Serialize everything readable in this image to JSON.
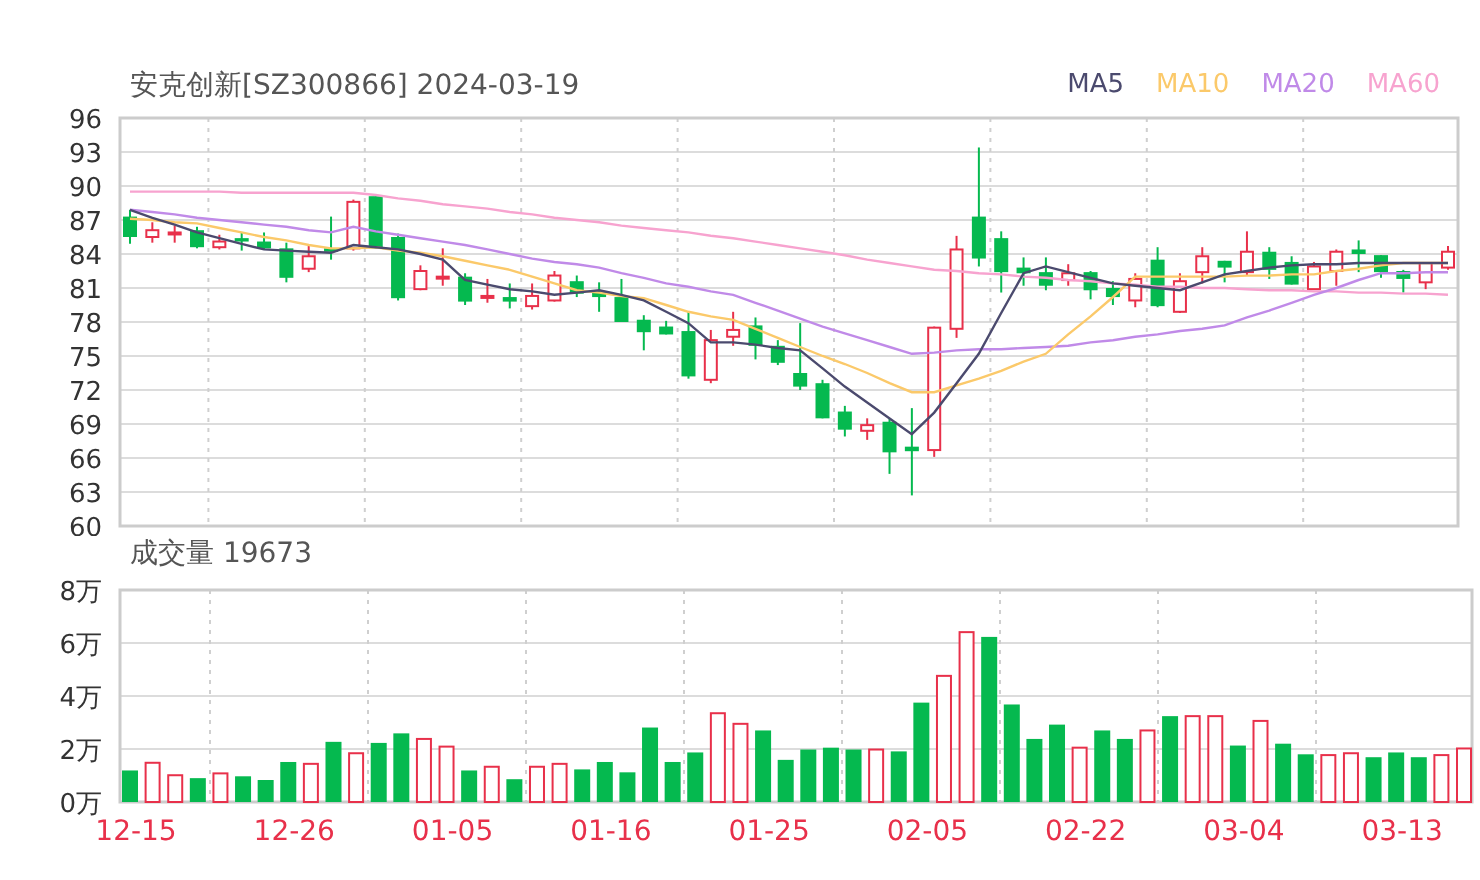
{
  "header": {
    "title": "安克创新[SZ300866] 2024-03-19"
  },
  "price_chart": {
    "chart_data": {
      "type": "candlestick",
      "grid": true,
      "categories": [
        null,
        null,
        null,
        null,
        null,
        null,
        null,
        null,
        null,
        null,
        null,
        null,
        null,
        null,
        null,
        null,
        null,
        null,
        null,
        null,
        null,
        null,
        null,
        null,
        null,
        null,
        null,
        null,
        null,
        null,
        null,
        null,
        null,
        null,
        null,
        null,
        null,
        null,
        null,
        null,
        null,
        null,
        null,
        null,
        null,
        null,
        null,
        null,
        null,
        null,
        null,
        null,
        null,
        null,
        null,
        null,
        null,
        null,
        null,
        null
      ],
      "ylim": [
        60,
        96
      ],
      "yticks": [
        60,
        63,
        66,
        69,
        72,
        75,
        78,
        81,
        84,
        87,
        90,
        93,
        96
      ],
      "ohlc": [
        [
          87.3,
          87.9,
          84.9,
          85.5
        ],
        [
          85.5,
          86.8,
          85.0,
          86.1
        ],
        [
          85.9,
          86.5,
          85.0,
          85.9
        ],
        [
          86.1,
          86.4,
          84.5,
          84.6
        ],
        [
          84.6,
          85.7,
          84.4,
          85.1
        ],
        [
          85.4,
          85.9,
          84.3,
          85.1
        ],
        [
          85.1,
          85.9,
          84.4,
          84.5
        ],
        [
          84.5,
          85.0,
          81.5,
          81.9
        ],
        [
          82.7,
          84.8,
          82.4,
          83.8
        ],
        [
          84.5,
          87.3,
          83.5,
          84.2
        ],
        [
          84.5,
          88.8,
          84.3,
          88.6
        ],
        [
          89.1,
          89.1,
          84.5,
          84.5
        ],
        [
          85.5,
          85.8,
          79.9,
          80.1
        ],
        [
          80.9,
          83.0,
          80.8,
          82.5
        ],
        [
          82.0,
          84.5,
          81.2,
          82.0
        ],
        [
          82.0,
          82.3,
          79.5,
          79.8
        ],
        [
          80.3,
          81.8,
          79.7,
          80.3
        ],
        [
          80.2,
          81.4,
          79.2,
          79.8
        ],
        [
          79.4,
          81.4,
          79.1,
          80.3
        ],
        [
          79.9,
          82.5,
          79.8,
          82.1
        ],
        [
          81.6,
          82.1,
          80.2,
          80.5
        ],
        [
          80.7,
          81.5,
          78.9,
          80.2
        ],
        [
          80.2,
          81.8,
          78.0,
          78.0
        ],
        [
          78.2,
          78.6,
          75.5,
          77.1
        ],
        [
          77.6,
          78.1,
          76.9,
          76.9
        ],
        [
          77.2,
          78.9,
          73.0,
          73.2
        ],
        [
          72.9,
          77.3,
          72.6,
          76.4
        ],
        [
          76.7,
          78.9,
          75.9,
          77.3
        ],
        [
          77.7,
          78.4,
          74.7,
          75.9
        ],
        [
          75.9,
          76.4,
          74.2,
          74.4
        ],
        [
          73.5,
          77.9,
          72.0,
          72.3
        ],
        [
          72.6,
          72.9,
          69.5,
          69.5
        ],
        [
          70.1,
          70.6,
          67.9,
          68.5
        ],
        [
          68.4,
          69.5,
          67.6,
          68.9
        ],
        [
          69.2,
          69.5,
          64.6,
          66.5
        ],
        [
          67.0,
          70.4,
          62.7,
          66.6
        ],
        [
          66.7,
          77.6,
          66.1,
          77.5
        ],
        [
          77.4,
          85.6,
          76.6,
          84.4
        ],
        [
          87.3,
          93.4,
          82.9,
          83.6
        ],
        [
          85.4,
          86.0,
          80.6,
          82.4
        ],
        [
          82.8,
          83.7,
          81.2,
          82.3
        ],
        [
          82.4,
          83.7,
          80.8,
          81.2
        ],
        [
          81.7,
          83.1,
          81.2,
          82.3
        ],
        [
          82.4,
          82.5,
          80.0,
          80.8
        ],
        [
          81.0,
          81.6,
          79.5,
          80.2
        ],
        [
          79.9,
          82.3,
          79.3,
          81.8
        ],
        [
          83.5,
          84.6,
          79.3,
          79.4
        ],
        [
          78.9,
          82.3,
          78.8,
          81.6
        ],
        [
          82.4,
          84.6,
          81.4,
          83.8
        ],
        [
          83.4,
          83.4,
          81.5,
          82.8
        ],
        [
          82.4,
          86.0,
          82.1,
          84.2
        ],
        [
          84.2,
          84.6,
          81.8,
          82.6
        ],
        [
          83.3,
          83.8,
          81.3,
          81.3
        ],
        [
          80.9,
          83.3,
          80.9,
          82.9
        ],
        [
          82.5,
          84.4,
          81.2,
          84.2
        ],
        [
          84.4,
          85.2,
          82.4,
          84.0
        ],
        [
          83.9,
          83.9,
          81.9,
          82.4
        ],
        [
          82.5,
          82.6,
          80.6,
          81.8
        ],
        [
          81.5,
          83.2,
          80.9,
          83.2
        ],
        [
          82.8,
          84.7,
          82.6,
          84.2
        ]
      ],
      "series": [
        {
          "name": "MA5",
          "type": "line",
          "color": "#4b4a6e",
          "values": [
            87.9,
            87.2,
            86.6,
            85.9,
            85.4,
            84.9,
            84.4,
            84.3,
            84.2,
            84.1,
            84.8,
            84.6,
            84.4,
            84.0,
            83.5,
            81.7,
            81.3,
            80.9,
            80.7,
            80.4,
            80.6,
            80.8,
            80.4,
            79.9,
            78.9,
            77.9,
            76.2,
            76.2,
            76.0,
            75.7,
            75.5,
            73.9,
            72.3,
            70.9,
            69.5,
            68.1,
            70.0,
            72.6,
            75.2,
            78.8,
            82.3,
            82.9,
            82.4,
            81.9,
            81.4,
            81.2,
            81.0,
            80.8,
            81.5,
            82.2,
            82.5,
            82.8,
            83.0,
            83.1,
            83.1,
            83.2,
            83.2,
            83.2,
            83.2,
            83.2
          ]
        },
        {
          "name": "MA10",
          "type": "line",
          "color": "#fbc96a",
          "values": [
            87.1,
            87.0,
            86.8,
            86.7,
            86.3,
            85.9,
            85.5,
            85.2,
            84.8,
            84.5,
            84.5,
            84.6,
            84.3,
            84.1,
            83.8,
            83.4,
            83.0,
            82.6,
            82.0,
            81.4,
            80.8,
            80.6,
            80.3,
            80.1,
            79.5,
            78.9,
            78.5,
            78.2,
            77.4,
            76.6,
            75.8,
            75.0,
            74.3,
            73.5,
            72.6,
            71.8,
            71.8,
            72.4,
            73.0,
            73.7,
            74.5,
            75.2,
            76.9,
            78.5,
            80.2,
            82.0,
            82.0,
            82.0,
            82.0,
            82.0,
            82.1,
            82.1,
            82.2,
            82.2,
            82.5,
            82.7,
            83.0,
            83.2,
            83.2,
            83.2
          ]
        },
        {
          "name": "MA20",
          "type": "line",
          "color": "#c08ae8",
          "values": [
            87.9,
            87.7,
            87.5,
            87.2,
            87.0,
            86.8,
            86.6,
            86.4,
            86.1,
            85.9,
            86.4,
            86.0,
            85.7,
            85.4,
            85.1,
            84.8,
            84.4,
            84.0,
            83.6,
            83.3,
            83.1,
            82.8,
            82.3,
            81.9,
            81.4,
            81.1,
            80.7,
            80.4,
            79.7,
            79.0,
            78.3,
            77.6,
            77.0,
            76.4,
            75.8,
            75.2,
            75.3,
            75.5,
            75.6,
            75.6,
            75.7,
            75.8,
            75.9,
            76.2,
            76.4,
            76.7,
            76.9,
            77.2,
            77.4,
            77.7,
            78.4,
            79.0,
            79.7,
            80.4,
            81.0,
            81.7,
            82.3,
            82.3,
            82.4,
            82.4
          ]
        },
        {
          "name": "MA60",
          "type": "line",
          "color": "#f7a3cf",
          "values": [
            89.5,
            89.5,
            89.5,
            89.5,
            89.5,
            89.4,
            89.4,
            89.4,
            89.4,
            89.4,
            89.4,
            89.2,
            88.9,
            88.7,
            88.4,
            88.2,
            88.0,
            87.7,
            87.5,
            87.2,
            87.0,
            86.8,
            86.5,
            86.3,
            86.1,
            85.9,
            85.6,
            85.4,
            85.1,
            84.8,
            84.5,
            84.2,
            83.9,
            83.5,
            83.2,
            82.9,
            82.6,
            82.5,
            82.3,
            82.2,
            82.0,
            81.9,
            81.7,
            81.6,
            81.4,
            81.3,
            81.1,
            81.1,
            81.0,
            81.0,
            80.9,
            80.8,
            80.8,
            80.7,
            80.7,
            80.6,
            80.6,
            80.5,
            80.5,
            80.4
          ]
        }
      ]
    }
  },
  "volume_chart": {
    "label": "成交量 19673",
    "chart_data": {
      "type": "bar",
      "grid": true,
      "categories": [
        "12-15",
        null,
        null,
        null,
        null,
        null,
        null,
        "12-26",
        null,
        null,
        null,
        null,
        null,
        null,
        "01-05",
        null,
        null,
        null,
        null,
        null,
        null,
        "01-16",
        null,
        null,
        null,
        null,
        null,
        null,
        "01-25",
        null,
        null,
        null,
        null,
        null,
        null,
        "02-05",
        null,
        null,
        null,
        null,
        null,
        null,
        "02-22",
        null,
        null,
        null,
        null,
        null,
        null,
        "03-04",
        null,
        null,
        null,
        null,
        null,
        null,
        "03-13",
        null,
        null,
        null
      ],
      "ylim": [
        0,
        8
      ],
      "yticks": [
        {
          "value": 0,
          "label": "0万"
        },
        {
          "value": 2,
          "label": "2万"
        },
        {
          "value": 4,
          "label": "4万"
        },
        {
          "value": 6,
          "label": "6万"
        },
        {
          "value": 8,
          "label": "8万"
        }
      ],
      "values": [
        1.19,
        1.48,
        1.01,
        0.9,
        1.08,
        0.97,
        0.83,
        1.51,
        1.44,
        2.27,
        1.84,
        2.23,
        2.59,
        2.38,
        2.09,
        1.19,
        1.33,
        0.86,
        1.33,
        1.44,
        1.23,
        1.51,
        1.12,
        2.81,
        1.51,
        1.87,
        3.35,
        2.95,
        2.7,
        1.59,
        1.98,
        2.05,
        1.98,
        1.98,
        1.91,
        3.75,
        4.76,
        6.41,
        6.23,
        3.68,
        2.38,
        2.92,
        2.05,
        2.7,
        2.38,
        2.7,
        3.24,
        3.24,
        3.24,
        2.13,
        3.06,
        2.2,
        1.8,
        1.77,
        1.84,
        1.69,
        1.87,
        1.69,
        1.77,
        2.02
      ]
    }
  }
}
